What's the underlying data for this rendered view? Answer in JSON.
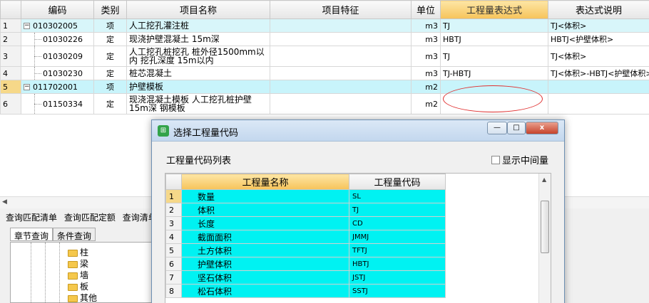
{
  "main": {
    "headers": [
      "",
      "编码",
      "类别",
      "项目名称",
      "项目特征",
      "单位",
      "工程量表达式",
      "表达式说明"
    ],
    "rows": [
      {
        "num": "1",
        "code": "010302005",
        "type": "项",
        "name": "人工挖孔灌注桩",
        "feature": "",
        "unit": "m3",
        "expr": "TJ",
        "desc": "TJ<体积>"
      },
      {
        "num": "2",
        "code": "01030226",
        "type": "定",
        "name": "现浇护壁混凝土 15m深",
        "feature": "",
        "unit": "m3",
        "expr": "HBTJ",
        "desc": "HBTJ<护壁体积>"
      },
      {
        "num": "3",
        "code": "01030209",
        "type": "定",
        "name": "人工挖孔桩挖孔 桩外径1500mm以内 挖孔深度 15m以内",
        "feature": "",
        "unit": "m3",
        "expr": "TJ",
        "desc": "TJ<体积>"
      },
      {
        "num": "4",
        "code": "01030230",
        "type": "定",
        "name": "桩芯混凝土",
        "feature": "",
        "unit": "m3",
        "expr": "TJ-HBTJ",
        "desc": "TJ<体积>-HBTJ<护壁体积>"
      },
      {
        "num": "5",
        "code": "011702001",
        "type": "项",
        "name": "护壁模板",
        "feature": "",
        "unit": "m2",
        "expr": "",
        "desc": ""
      },
      {
        "num": "6",
        "code": "01150334",
        "type": "定",
        "name": "现浇混凝土模板 人工挖孔桩护壁 15m深 钢模板",
        "feature": "",
        "unit": "m2",
        "expr": "",
        "desc": ""
      }
    ]
  },
  "bottom": {
    "tabs": [
      "查询匹配清单",
      "查询匹配定额",
      "查询清单"
    ],
    "subtabs": [
      "章节查询",
      "条件查询"
    ],
    "tree": [
      "柱",
      "梁",
      "墙",
      "板",
      "其他"
    ]
  },
  "dialog": {
    "title": "选择工程量代码",
    "list_label": "工程量代码列表",
    "checkbox_label": "显示中间量",
    "headers": [
      "",
      "工程量名称",
      "工程量代码"
    ],
    "rows": [
      {
        "num": "1",
        "name": "数量",
        "code": "SL"
      },
      {
        "num": "2",
        "name": "体积",
        "code": "TJ"
      },
      {
        "num": "3",
        "name": "长度",
        "code": "CD"
      },
      {
        "num": "4",
        "name": "截面面积",
        "code": "JMMJ"
      },
      {
        "num": "5",
        "name": "土方体积",
        "code": "TFTJ"
      },
      {
        "num": "6",
        "name": "护壁体积",
        "code": "HBTJ"
      },
      {
        "num": "7",
        "name": "坚石体积",
        "code": "JSTJ"
      },
      {
        "num": "8",
        "name": "松石体积",
        "code": "SSTJ"
      }
    ],
    "buttons": {
      "minimize": "—",
      "restore": "□",
      "close": "x"
    }
  },
  "colors": {
    "selected_row": "#d8f6fa",
    "cyan_cell": "#00f2f2",
    "header_highlight": "#f6c35a",
    "annotation": "#e03030"
  }
}
